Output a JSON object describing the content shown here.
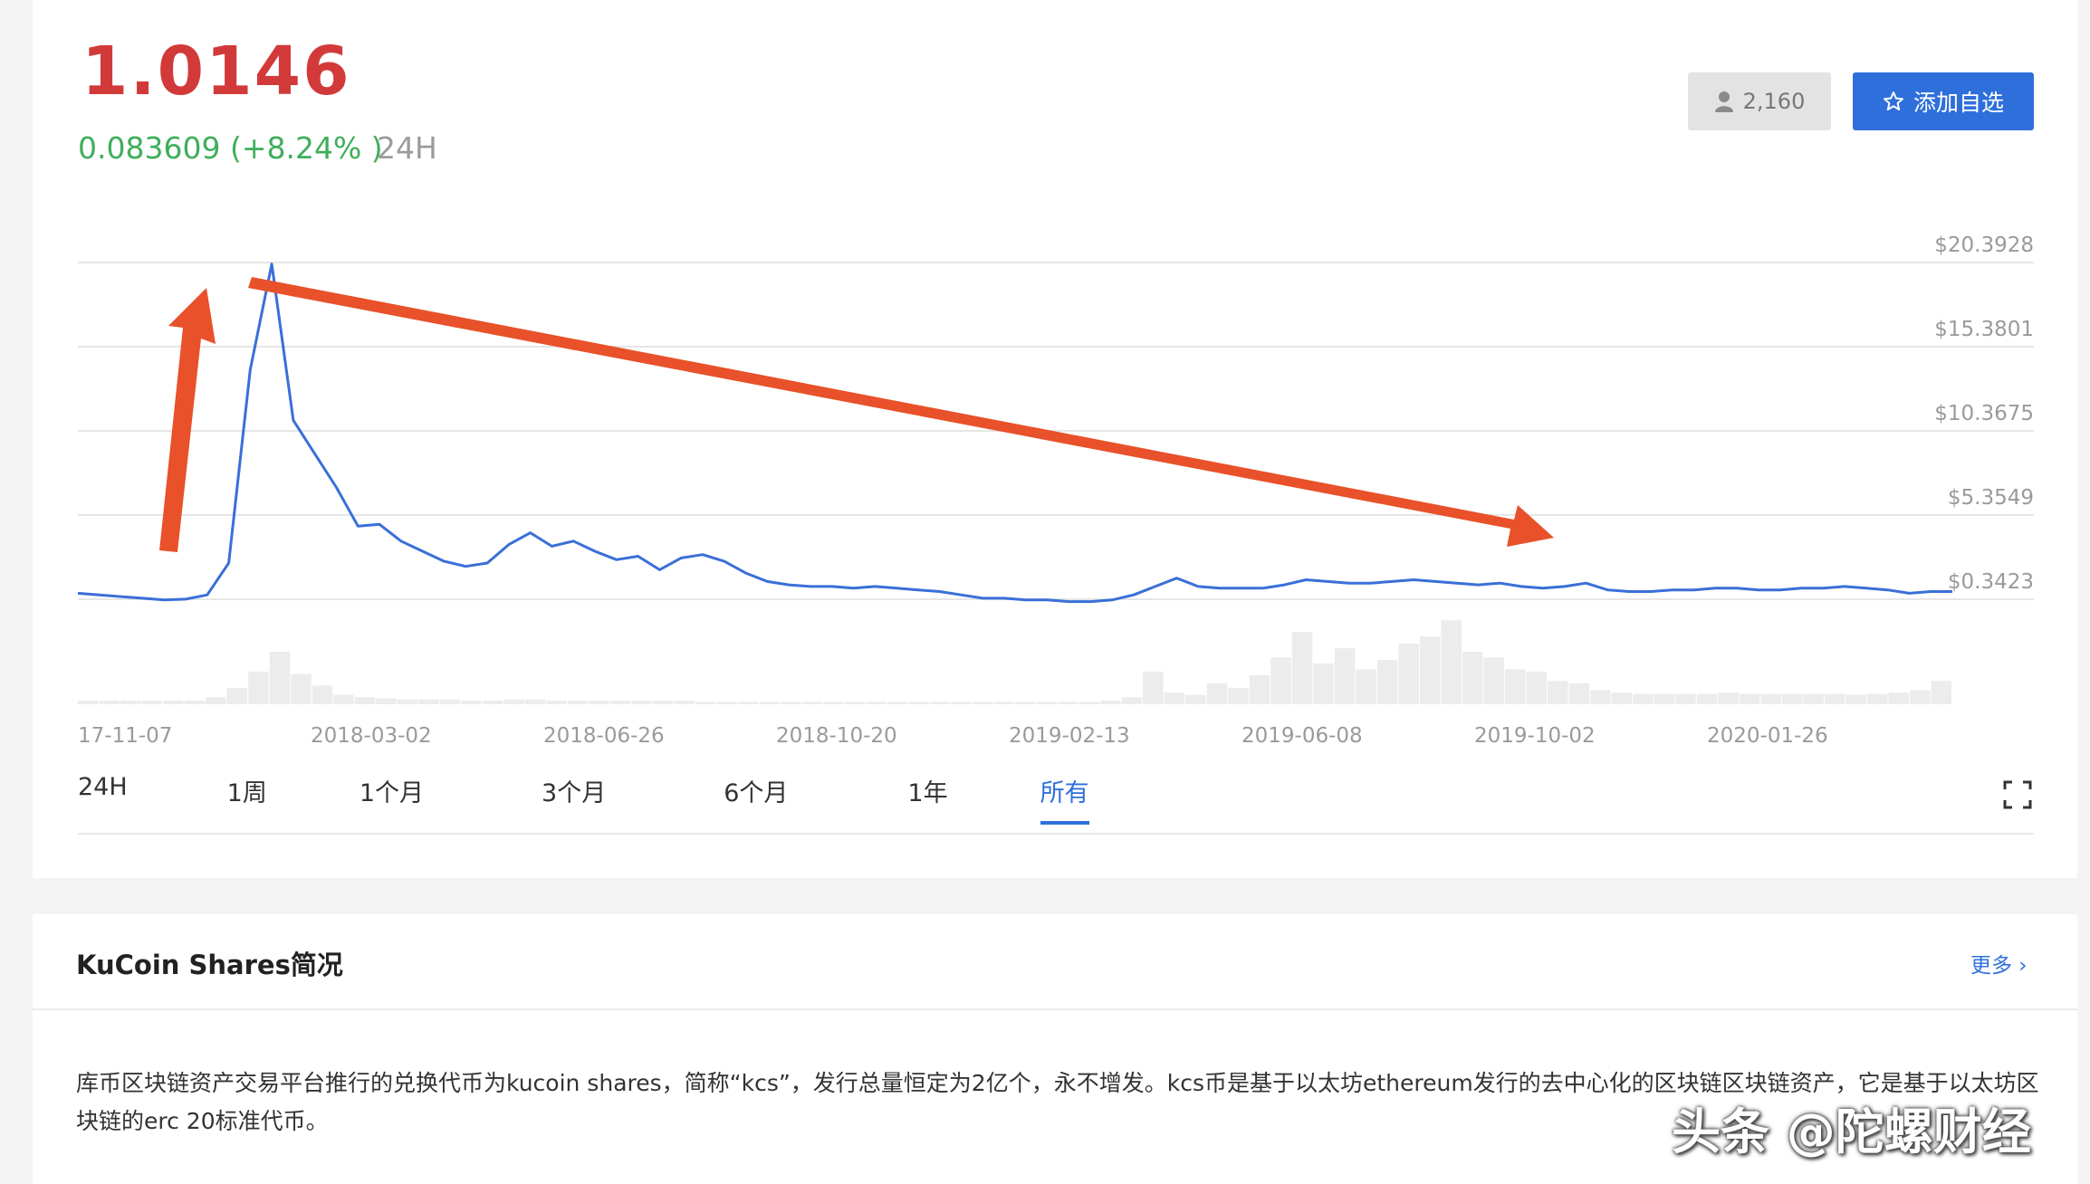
{
  "price": {
    "current": "1.0146",
    "change": "0.083609 (+8.24% )",
    "period": "24H"
  },
  "actions": {
    "followers": "2,160",
    "add_label": "添加自选"
  },
  "tabs": [
    "24H",
    "1周",
    "1个月",
    "3个月",
    "6个月",
    "1年",
    "所有"
  ],
  "active_tab": "所有",
  "colors": {
    "price_up": "#d23a3a",
    "change_up": "#3fae5a",
    "accent": "#2f6fdb",
    "line": "#3a6fd8",
    "arrow": "#e8512a"
  },
  "chart_data": {
    "type": "line",
    "y_axis_labels": [
      "$20.3928",
      "$15.3801",
      "$10.3675",
      "$5.3549",
      "$0.3423"
    ],
    "x_axis_labels": [
      "17-11-07",
      "2018-03-02",
      "2018-06-26",
      "2018-10-20",
      "2019-02-13",
      "2019-06-08",
      "2019-10-02",
      "2020-01-26"
    ],
    "ylim": [
      0.3423,
      20.3928
    ],
    "series": [
      {
        "values": [
          0.7,
          0.6,
          0.5,
          0.4,
          0.3,
          0.35,
          0.6,
          2.5,
          14,
          20.3,
          11,
          9,
          7,
          4.7,
          4.8,
          3.8,
          3.2,
          2.6,
          2.3,
          2.5,
          3.6,
          4.3,
          3.5,
          3.8,
          3.2,
          2.7,
          2.9,
          2.1,
          2.8,
          3.0,
          2.6,
          1.9,
          1.4,
          1.2,
          1.1,
          1.1,
          1.0,
          1.1,
          1.0,
          0.9,
          0.8,
          0.6,
          0.4,
          0.4,
          0.3,
          0.3,
          0.2,
          0.2,
          0.3,
          0.6,
          1.1,
          1.6,
          1.1,
          1.0,
          1.0,
          1.0,
          1.2,
          1.5,
          1.4,
          1.3,
          1.3,
          1.4,
          1.5,
          1.4,
          1.3,
          1.2,
          1.3,
          1.1,
          1.0,
          1.1,
          1.3,
          0.9,
          0.8,
          0.8,
          0.9,
          0.9,
          1.0,
          1.0,
          0.9,
          0.9,
          1.0,
          1.0,
          1.1,
          1.0,
          0.9,
          0.7,
          0.8,
          0.8
        ]
      }
    ],
    "volume": [
      3,
      3,
      3,
      3,
      3,
      3,
      6,
      14,
      28,
      45,
      26,
      16,
      8,
      6,
      5,
      4,
      4,
      4,
      3,
      3,
      4,
      4,
      3,
      3,
      3,
      3,
      3,
      3,
      3,
      2,
      2,
      2,
      2,
      2,
      2,
      2,
      2,
      2,
      2,
      2,
      2,
      2,
      2,
      2,
      2,
      2,
      2,
      2,
      3,
      6,
      28,
      10,
      8,
      18,
      14,
      25,
      40,
      62,
      35,
      48,
      30,
      38,
      52,
      58,
      72,
      45,
      40,
      30,
      28,
      20,
      18,
      12,
      10,
      9,
      9,
      9,
      9,
      10,
      9,
      9,
      9,
      9,
      9,
      8,
      9,
      10,
      12,
      20
    ],
    "annotations": [
      "rising arrow",
      "falling arrow"
    ],
    "grid": true
  },
  "section": {
    "title": "KuCoin Shares简况",
    "more": "更多 ›",
    "description": "库币区块链资产交易平台推行的兑换代币为kucoin shares，简称“kcs”，发行总量恒定为2亿个，永不增发。kcs币是基于以太坊ethereum发行的去中心化的区块链区块链资产，它是基于以太坊区块链的erc 20标准代币。"
  },
  "watermark": "头条 @陀螺财经"
}
